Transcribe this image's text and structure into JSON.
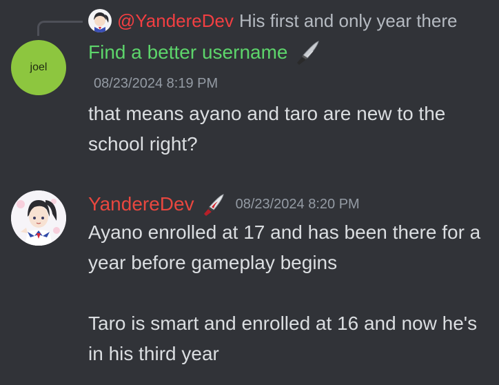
{
  "reply": {
    "username": "@YandereDev",
    "text": "His first and only year there",
    "avatar_icon": "anime-avatar-icon"
  },
  "message1": {
    "avatar_text": "joel",
    "avatar_color": "#8dc63f",
    "username": "Find a better username",
    "username_color": "#5dd56b",
    "badge_icon": "knife-icon",
    "timestamp": "08/23/2024 8:19 PM",
    "text": "that means ayano and taro are new to the school right?"
  },
  "message2": {
    "username": "YandereDev",
    "username_color": "#e8473f",
    "badge_icon": "bloody-knife-icon",
    "timestamp": "08/23/2024 8:20 PM",
    "paragraph1": "Ayano enrolled at 17 and has been there for a year  before gameplay begins",
    "paragraph2": "Taro is smart and enrolled at 16 and now he's in his third year"
  }
}
